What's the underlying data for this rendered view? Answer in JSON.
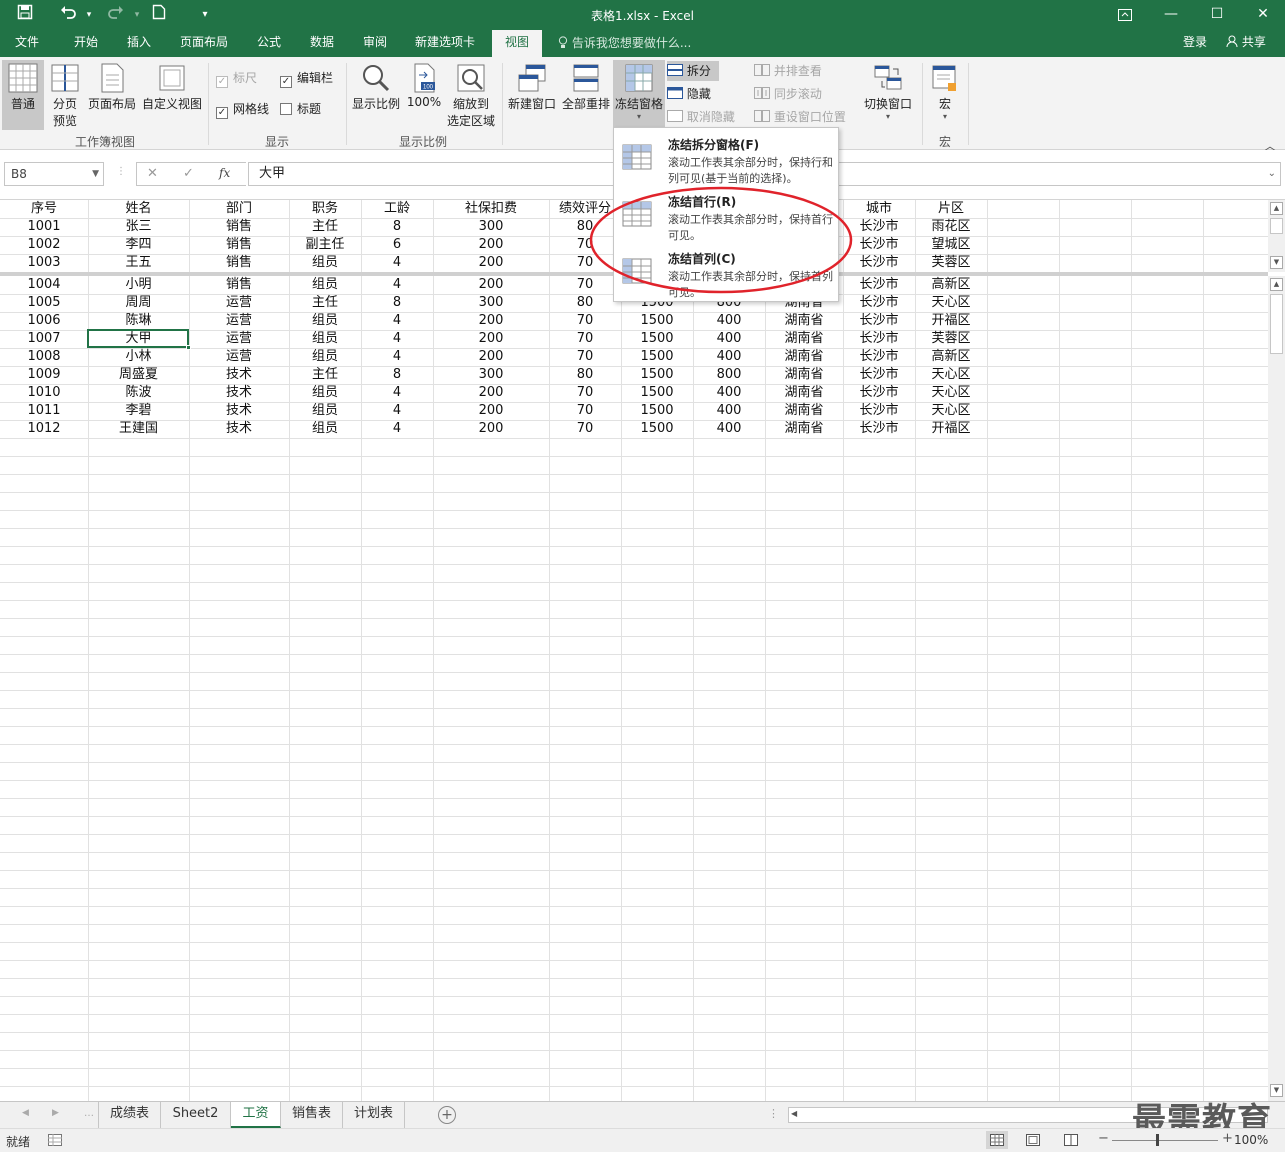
{
  "window": {
    "title": "表格1.xlsx - Excel",
    "controls": {
      "ribbon_options": "⊡",
      "minimize": "—",
      "maximize": "☐",
      "close": "✕"
    }
  },
  "quick_access": {
    "save": "💾",
    "undo": "↶",
    "redo": "↷",
    "new": "🗋",
    "customize": "▾"
  },
  "tabs": {
    "items": [
      "文件",
      "开始",
      "插入",
      "页面布局",
      "公式",
      "数据",
      "审阅",
      "新建选项卡",
      "视图"
    ],
    "active": "视图",
    "tell_me": "告诉我您想要做什么...",
    "signin": "登录",
    "share": "共享"
  },
  "ribbon": {
    "workbook_views": {
      "label": "工作簿视图",
      "normal": "普通",
      "page_break_1": "分页",
      "page_break_2": "预览",
      "page_layout": "页面布局",
      "custom_views": "自定义视图"
    },
    "show": {
      "label": "显示",
      "ruler": "标尺",
      "formula_bar": "编辑栏",
      "gridlines": "网格线",
      "headings": "标题"
    },
    "zoom": {
      "label": "显示比例",
      "zoom": "显示比例",
      "hundred": "100%",
      "zoom_sel_1": "缩放到",
      "zoom_sel_2": "选定区域"
    },
    "window": {
      "new_window": "新建窗口",
      "arrange_all": "全部重排",
      "freeze_panes": "冻结窗格",
      "split": "拆分",
      "hide": "隐藏",
      "unhide": "取消隐藏",
      "side_by_side": "并排查看",
      "sync_scroll": "同步滚动",
      "reset_position": "重设窗口位置",
      "switch_windows": "切换窗口"
    },
    "macros": {
      "label": "宏",
      "macros": "宏"
    }
  },
  "formula_bar": {
    "name_box": "B8",
    "cancel": "✕",
    "enter": "✓",
    "fx": "fx",
    "value": "大甲"
  },
  "freeze_menu": {
    "items": [
      {
        "title": "冻结拆分窗格(F)",
        "desc": "滚动工作表其余部分时，保持行和列可见(基于当前的选择)。"
      },
      {
        "title": "冻结首行(R)",
        "desc": "滚动工作表其余部分时，保持首行可见。"
      },
      {
        "title": "冻结首列(C)",
        "desc": "滚动工作表其余部分时，保持首列可见。"
      }
    ]
  },
  "sheet": {
    "headers": [
      "序号",
      "姓名",
      "部门",
      "职务",
      "工龄",
      "社保扣费",
      "绩效评分",
      "",
      "",
      "",
      "城市",
      "片区"
    ],
    "top_rows": [
      [
        "1001",
        "张三",
        "销售",
        "主任",
        "8",
        "300",
        "80",
        "",
        "",
        "",
        "长沙市",
        "雨花区"
      ],
      [
        "1002",
        "李四",
        "销售",
        "副主任",
        "6",
        "200",
        "70",
        "",
        "",
        "",
        "长沙市",
        "望城区"
      ],
      [
        "1003",
        "王五",
        "销售",
        "组员",
        "4",
        "200",
        "70",
        "",
        "",
        "",
        "长沙市",
        "芙蓉区"
      ]
    ],
    "bottom_rows": [
      [
        "1004",
        "小明",
        "销售",
        "组员",
        "4",
        "200",
        "70",
        "",
        "",
        "",
        "长沙市",
        "高新区"
      ],
      [
        "1005",
        "周周",
        "运营",
        "主任",
        "8",
        "300",
        "80",
        "1500",
        "800",
        "湖南省",
        "长沙市",
        "天心区"
      ],
      [
        "1006",
        "陈琳",
        "运营",
        "组员",
        "4",
        "200",
        "70",
        "1500",
        "400",
        "湖南省",
        "长沙市",
        "开福区"
      ],
      [
        "1007",
        "大甲",
        "运营",
        "组员",
        "4",
        "200",
        "70",
        "1500",
        "400",
        "湖南省",
        "长沙市",
        "芙蓉区"
      ],
      [
        "1008",
        "小林",
        "运营",
        "组员",
        "4",
        "200",
        "70",
        "1500",
        "400",
        "湖南省",
        "长沙市",
        "高新区"
      ],
      [
        "1009",
        "周盛夏",
        "技术",
        "主任",
        "8",
        "300",
        "80",
        "1500",
        "800",
        "湖南省",
        "长沙市",
        "天心区"
      ],
      [
        "1010",
        "陈波",
        "技术",
        "组员",
        "4",
        "200",
        "70",
        "1500",
        "400",
        "湖南省",
        "长沙市",
        "天心区"
      ],
      [
        "1011",
        "李碧",
        "技术",
        "组员",
        "4",
        "200",
        "70",
        "1500",
        "400",
        "湖南省",
        "长沙市",
        "天心区"
      ],
      [
        "1012",
        "王建国",
        "技术",
        "组员",
        "4",
        "200",
        "70",
        "1500",
        "400",
        "湖南省",
        "长沙市",
        "开福区"
      ]
    ]
  },
  "sheet_tabs": {
    "items": [
      "成绩表",
      "Sheet2",
      "工资",
      "销售表",
      "计划表"
    ],
    "active": "工资",
    "add": "+"
  },
  "status": {
    "ready": "就绪",
    "zoom": "100%"
  },
  "watermark": "最需教育",
  "colors": {
    "accent": "#217346",
    "annotation": "#e0232b"
  }
}
